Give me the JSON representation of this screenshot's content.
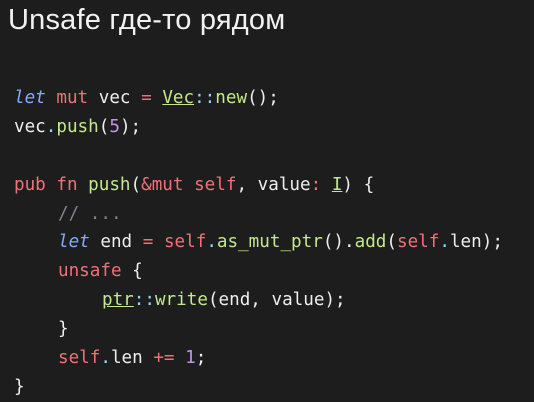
{
  "slide": {
    "title": "Unsafe где-то рядом"
  },
  "code": {
    "lines": [
      [
        {
          "t": "let",
          "c": "kw-italic"
        },
        {
          "t": " ",
          "c": "plain"
        },
        {
          "t": "mut",
          "c": "kw"
        },
        {
          "t": " vec ",
          "c": "plain"
        },
        {
          "t": "=",
          "c": "op"
        },
        {
          "t": " ",
          "c": "plain"
        },
        {
          "t": "Vec",
          "c": "type"
        },
        {
          "t": "::",
          "c": "punc"
        },
        {
          "t": "new",
          "c": "fn"
        },
        {
          "t": "();",
          "c": "plain"
        }
      ],
      [
        {
          "t": "vec",
          "c": "plain"
        },
        {
          "t": ".",
          "c": "punc"
        },
        {
          "t": "push",
          "c": "fn"
        },
        {
          "t": "(",
          "c": "plain"
        },
        {
          "t": "5",
          "c": "num2"
        },
        {
          "t": ");",
          "c": "plain"
        }
      ],
      [],
      [
        {
          "t": "pub",
          "c": "kw"
        },
        {
          "t": " ",
          "c": "plain"
        },
        {
          "t": "fn",
          "c": "kw"
        },
        {
          "t": " ",
          "c": "plain"
        },
        {
          "t": "push",
          "c": "fn"
        },
        {
          "t": "(",
          "c": "plain"
        },
        {
          "t": "&mut",
          "c": "kw"
        },
        {
          "t": " ",
          "c": "plain"
        },
        {
          "t": "self",
          "c": "self"
        },
        {
          "t": ", value",
          "c": "plain"
        },
        {
          "t": ":",
          "c": "op"
        },
        {
          "t": " ",
          "c": "plain"
        },
        {
          "t": "I",
          "c": "gen"
        },
        {
          "t": ") {",
          "c": "plain"
        }
      ],
      [
        {
          "t": "// ...",
          "c": "comment",
          "indent": 1
        }
      ],
      [
        {
          "t": "let",
          "c": "kw-italic",
          "indent": 1
        },
        {
          "t": " end ",
          "c": "plain"
        },
        {
          "t": "=",
          "c": "op"
        },
        {
          "t": " ",
          "c": "plain"
        },
        {
          "t": "self",
          "c": "self"
        },
        {
          "t": ".",
          "c": "punc"
        },
        {
          "t": "as_mut_ptr",
          "c": "fn"
        },
        {
          "t": "().",
          "c": "plain"
        },
        {
          "t": "add",
          "c": "fn"
        },
        {
          "t": "(",
          "c": "plain"
        },
        {
          "t": "self",
          "c": "self"
        },
        {
          "t": ".",
          "c": "punc"
        },
        {
          "t": "len);",
          "c": "plain"
        }
      ],
      [
        {
          "t": "unsafe",
          "c": "kw",
          "indent": 1
        },
        {
          "t": " {",
          "c": "plain"
        }
      ],
      [
        {
          "t": "ptr",
          "c": "type",
          "indent": 2
        },
        {
          "t": "::",
          "c": "punc"
        },
        {
          "t": "write",
          "c": "fn"
        },
        {
          "t": "(end, value);",
          "c": "plain"
        }
      ],
      [
        {
          "t": "}",
          "c": "plain",
          "indent": 1
        }
      ],
      [
        {
          "t": "self",
          "c": "self",
          "indent": 1
        },
        {
          "t": ".",
          "c": "punc"
        },
        {
          "t": "len ",
          "c": "plain"
        },
        {
          "t": "+=",
          "c": "op"
        },
        {
          "t": " ",
          "c": "plain"
        },
        {
          "t": "1",
          "c": "num2"
        },
        {
          "t": ";",
          "c": "plain"
        }
      ],
      [
        {
          "t": "}",
          "c": "plain"
        }
      ]
    ]
  }
}
